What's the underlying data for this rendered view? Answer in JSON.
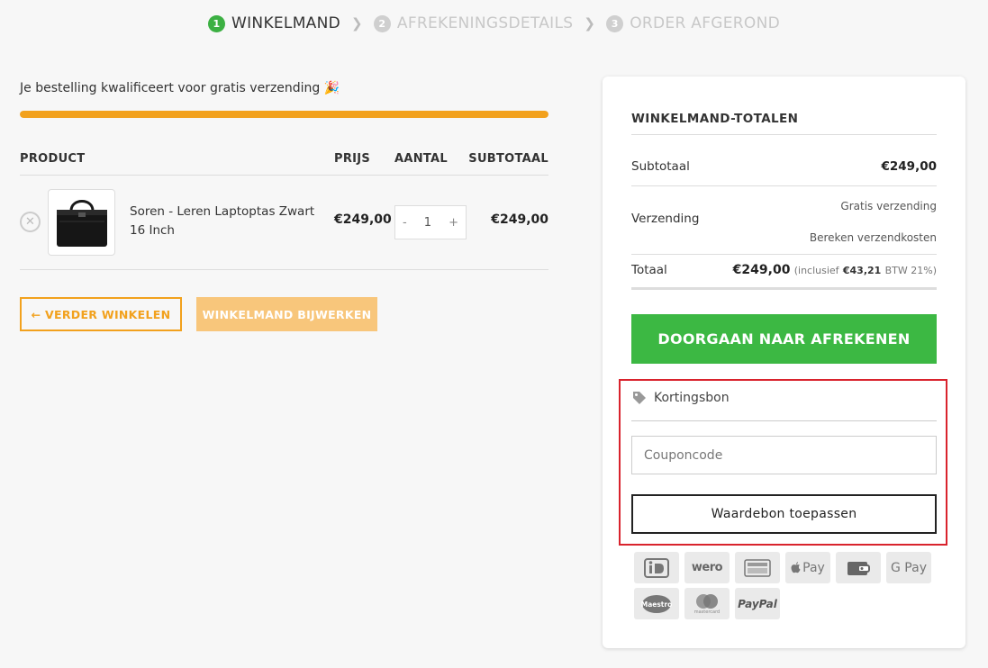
{
  "steps": [
    {
      "num": "1",
      "label": "WINKELMAND",
      "active": true
    },
    {
      "num": "2",
      "label": "AFREKENINGSDETAILS",
      "active": false
    },
    {
      "num": "3",
      "label": "ORDER AFGEROND",
      "active": false
    }
  ],
  "shipping": {
    "message": "Je bestelling kwalificeert voor gratis verzending",
    "emoji": "🎉",
    "progress_fraction": 1.0
  },
  "cart": {
    "headers": {
      "product": "PRODUCT",
      "price": "PRIJS",
      "qty": "AANTAL",
      "subtotal": "SUBTOTAAL"
    },
    "items": [
      {
        "name": "Soren - Leren Laptoptas Zwart 16 Inch",
        "price": "€249,00",
        "qty": "1",
        "subtotal": "€249,00"
      }
    ],
    "continue_label": "← VERDER WINKELEN",
    "update_label": "WINKELMAND BIJWERKEN"
  },
  "totals": {
    "title": "WINKELMAND-TOTALEN",
    "subtotal_label": "Subtotaal",
    "subtotal_value": "€249,00",
    "shipping_label": "Verzending",
    "shipping_value": "Gratis verzending",
    "shipping_calc": "Bereken verzendkosten",
    "total_label": "Totaal",
    "total_value": "€249,00",
    "tax_prefix": "(inclusief",
    "tax_amount": "€43,21",
    "tax_suffix": "BTW 21%)",
    "checkout_label": "DOORGAAN NAAR AFREKENEN"
  },
  "coupon": {
    "label": "Kortingsbon",
    "placeholder": "Couponcode",
    "button_label": "Waardebon toepassen"
  },
  "payment_methods": [
    "iDEAL",
    "wero",
    "Bancontact",
    "Apple Pay",
    "cash",
    "G Pay",
    "Maestro",
    "mastercard",
    "PayPal"
  ],
  "colors": {
    "accent": "#f2a11d",
    "checkout": "#3cb843",
    "step_active": "#3cb043",
    "highlight": "#d9232d"
  }
}
